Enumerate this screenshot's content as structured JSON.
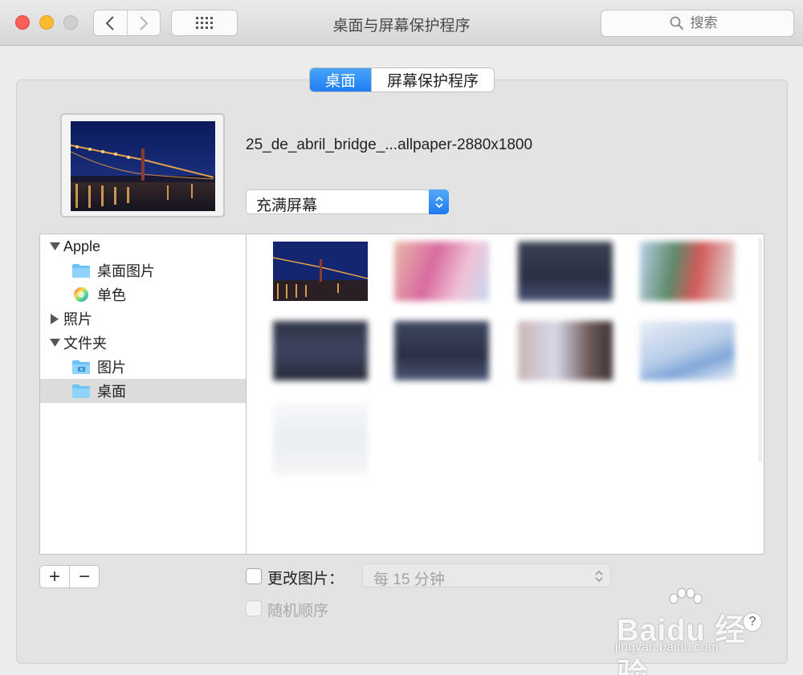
{
  "window": {
    "title": "桌面与屏幕保护程序"
  },
  "toolbar": {
    "search_placeholder": "搜索"
  },
  "tabs": [
    {
      "label": "桌面",
      "active": true
    },
    {
      "label": "屏幕保护程序",
      "active": false
    }
  ],
  "current": {
    "filename": "25_de_abril_bridge_...allpaper-2880x1800",
    "fit_option": "充满屏幕"
  },
  "sidebar": {
    "items": [
      {
        "label": "Apple",
        "type": "group",
        "expanded": true
      },
      {
        "label": "桌面图片",
        "type": "folder"
      },
      {
        "label": "单色",
        "type": "color"
      },
      {
        "label": "照片",
        "type": "group",
        "expanded": false
      },
      {
        "label": "文件夹",
        "type": "group",
        "expanded": true
      },
      {
        "label": "图片",
        "type": "photo-folder"
      },
      {
        "label": "桌面",
        "type": "folder",
        "selected": true
      }
    ]
  },
  "buttons": {
    "add": "+",
    "remove": "−"
  },
  "options": {
    "change_picture_label": "更改图片：",
    "change_picture_checked": false,
    "interval": "每 15 分钟",
    "random_order_label": "随机顺序",
    "random_order_checked": false
  },
  "help": "?",
  "watermark": {
    "brand": "Baidu 经验",
    "url": "jingyan.baidu.com"
  },
  "colors": {
    "accent": "#1f7ef2",
    "selection": "#dcdcdc"
  }
}
